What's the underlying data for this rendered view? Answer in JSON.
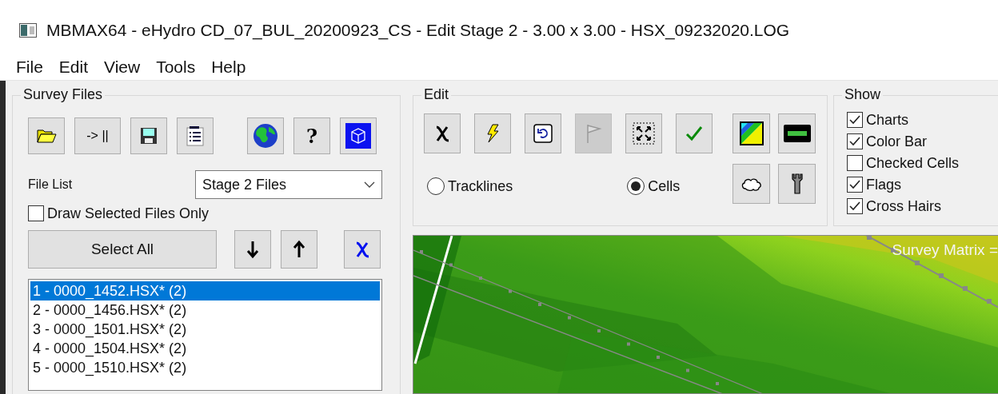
{
  "window": {
    "title": "MBMAX64 - eHydro CD_07_BUL_20200923_CS - Edit Stage 2 - 3.00 x 3.00 - HSX_09232020.LOG"
  },
  "menu": [
    "File",
    "Edit",
    "View",
    "Tools",
    "Help"
  ],
  "survey_files": {
    "title": "Survey Files",
    "toolbar": [
      {
        "kind": "folder"
      },
      {
        "kind": "text",
        "label": "-> ||"
      },
      {
        "kind": "save"
      },
      {
        "kind": "list"
      },
      {
        "kind": "globe"
      },
      {
        "kind": "text",
        "label": "?"
      },
      {
        "kind": "cube"
      }
    ],
    "file_list_label": "File List",
    "file_list_dropdown": {
      "value": "Stage 2 Files"
    },
    "draw_selected_only": {
      "label": "Draw Selected Files Only",
      "checked": false
    },
    "select_all": "Select All",
    "list_tools": [
      {
        "kind": "arrow-down"
      },
      {
        "kind": "arrow-up"
      },
      {
        "kind": "blue-cross"
      }
    ],
    "files": [
      {
        "label": "1 - 0000_1452.HSX* (2)",
        "selected": true
      },
      {
        "label": "2 - 0000_1456.HSX* (2)",
        "selected": false
      },
      {
        "label": "3 - 0000_1501.HSX* (2)",
        "selected": false
      },
      {
        "label": "4 - 0000_1504.HSX* (2)",
        "selected": false
      },
      {
        "label": "5 - 0000_1510.HSX* (2)",
        "selected": false
      }
    ]
  },
  "edit": {
    "title": "Edit",
    "tools": [
      {
        "kind": "cross",
        "disabled": false
      },
      {
        "kind": "bolt",
        "disabled": false
      },
      {
        "kind": "undo",
        "disabled": false
      },
      {
        "kind": "flag",
        "disabled": true
      },
      {
        "kind": "fit",
        "disabled": false
      },
      {
        "kind": "check",
        "disabled": false
      }
    ],
    "side_tools": [
      {
        "kind": "colormap"
      },
      {
        "kind": "colorbar"
      },
      {
        "kind": "cloud"
      },
      {
        "kind": "wrench"
      }
    ],
    "modes": [
      {
        "label": "Tracklines",
        "selected": false
      },
      {
        "label": "Cells",
        "selected": true
      }
    ]
  },
  "show": {
    "title": "Show",
    "options": [
      {
        "label": "Charts",
        "checked": true
      },
      {
        "label": "Color Bar",
        "checked": true
      },
      {
        "label": "Checked Cells",
        "checked": false
      },
      {
        "label": "Flags",
        "checked": true
      },
      {
        "label": "Cross Hairs",
        "checked": true
      }
    ]
  },
  "map": {
    "overlay_label": "Survey Matrix ="
  }
}
